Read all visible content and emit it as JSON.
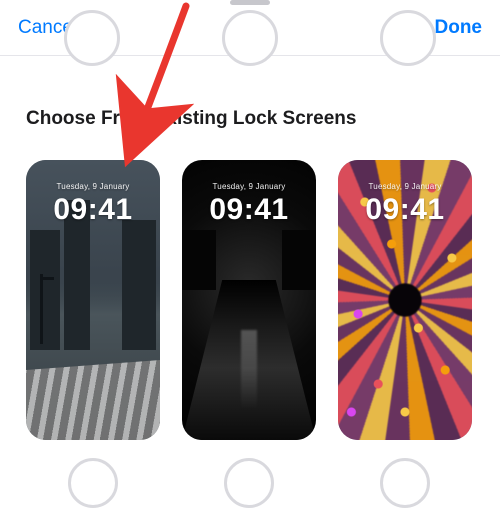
{
  "header": {
    "cancel_label": "Cancel",
    "done_label": "Done"
  },
  "section": {
    "title": "Choose From Existing Lock Screens"
  },
  "lockscreens": [
    {
      "date": "Tuesday, 9 January",
      "time": "09:41",
      "style": "city-rain"
    },
    {
      "date": "Tuesday, 9 January",
      "time": "09:41",
      "style": "dark-street"
    },
    {
      "date": "Tuesday, 9 January",
      "time": "09:41",
      "style": "emoji-spiral"
    }
  ],
  "colors": {
    "accent": "#007aff",
    "annotation": "#e9362e"
  }
}
